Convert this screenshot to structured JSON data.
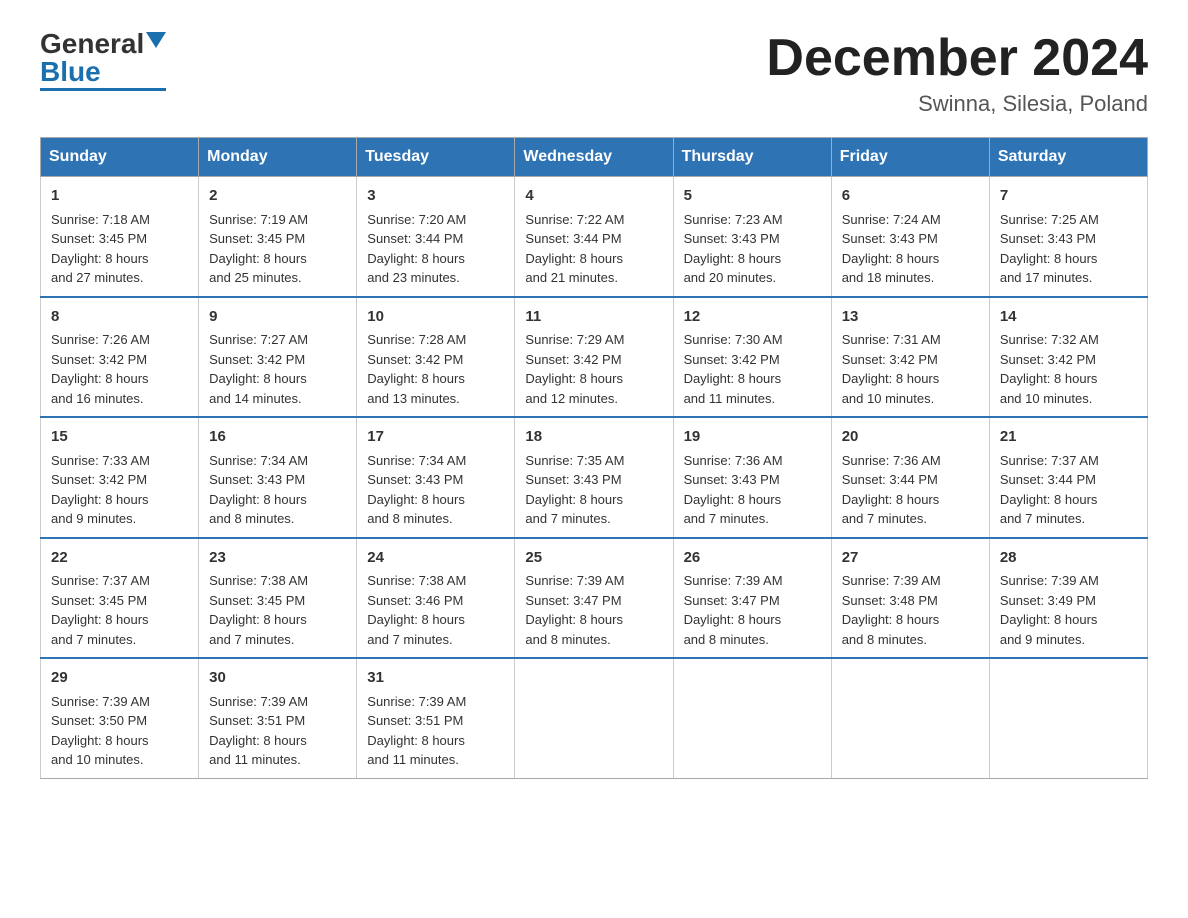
{
  "header": {
    "logo_text_general": "General",
    "logo_text_blue": "Blue",
    "month_title": "December 2024",
    "location": "Swinna, Silesia, Poland"
  },
  "days_of_week": [
    "Sunday",
    "Monday",
    "Tuesday",
    "Wednesday",
    "Thursday",
    "Friday",
    "Saturday"
  ],
  "weeks": [
    [
      {
        "day": "1",
        "sunrise": "7:18 AM",
        "sunset": "3:45 PM",
        "daylight": "8 hours and 27 minutes."
      },
      {
        "day": "2",
        "sunrise": "7:19 AM",
        "sunset": "3:45 PM",
        "daylight": "8 hours and 25 minutes."
      },
      {
        "day": "3",
        "sunrise": "7:20 AM",
        "sunset": "3:44 PM",
        "daylight": "8 hours and 23 minutes."
      },
      {
        "day": "4",
        "sunrise": "7:22 AM",
        "sunset": "3:44 PM",
        "daylight": "8 hours and 21 minutes."
      },
      {
        "day": "5",
        "sunrise": "7:23 AM",
        "sunset": "3:43 PM",
        "daylight": "8 hours and 20 minutes."
      },
      {
        "day": "6",
        "sunrise": "7:24 AM",
        "sunset": "3:43 PM",
        "daylight": "8 hours and 18 minutes."
      },
      {
        "day": "7",
        "sunrise": "7:25 AM",
        "sunset": "3:43 PM",
        "daylight": "8 hours and 17 minutes."
      }
    ],
    [
      {
        "day": "8",
        "sunrise": "7:26 AM",
        "sunset": "3:42 PM",
        "daylight": "8 hours and 16 minutes."
      },
      {
        "day": "9",
        "sunrise": "7:27 AM",
        "sunset": "3:42 PM",
        "daylight": "8 hours and 14 minutes."
      },
      {
        "day": "10",
        "sunrise": "7:28 AM",
        "sunset": "3:42 PM",
        "daylight": "8 hours and 13 minutes."
      },
      {
        "day": "11",
        "sunrise": "7:29 AM",
        "sunset": "3:42 PM",
        "daylight": "8 hours and 12 minutes."
      },
      {
        "day": "12",
        "sunrise": "7:30 AM",
        "sunset": "3:42 PM",
        "daylight": "8 hours and 11 minutes."
      },
      {
        "day": "13",
        "sunrise": "7:31 AM",
        "sunset": "3:42 PM",
        "daylight": "8 hours and 10 minutes."
      },
      {
        "day": "14",
        "sunrise": "7:32 AM",
        "sunset": "3:42 PM",
        "daylight": "8 hours and 10 minutes."
      }
    ],
    [
      {
        "day": "15",
        "sunrise": "7:33 AM",
        "sunset": "3:42 PM",
        "daylight": "8 hours and 9 minutes."
      },
      {
        "day": "16",
        "sunrise": "7:34 AM",
        "sunset": "3:43 PM",
        "daylight": "8 hours and 8 minutes."
      },
      {
        "day": "17",
        "sunrise": "7:34 AM",
        "sunset": "3:43 PM",
        "daylight": "8 hours and 8 minutes."
      },
      {
        "day": "18",
        "sunrise": "7:35 AM",
        "sunset": "3:43 PM",
        "daylight": "8 hours and 7 minutes."
      },
      {
        "day": "19",
        "sunrise": "7:36 AM",
        "sunset": "3:43 PM",
        "daylight": "8 hours and 7 minutes."
      },
      {
        "day": "20",
        "sunrise": "7:36 AM",
        "sunset": "3:44 PM",
        "daylight": "8 hours and 7 minutes."
      },
      {
        "day": "21",
        "sunrise": "7:37 AM",
        "sunset": "3:44 PM",
        "daylight": "8 hours and 7 minutes."
      }
    ],
    [
      {
        "day": "22",
        "sunrise": "7:37 AM",
        "sunset": "3:45 PM",
        "daylight": "8 hours and 7 minutes."
      },
      {
        "day": "23",
        "sunrise": "7:38 AM",
        "sunset": "3:45 PM",
        "daylight": "8 hours and 7 minutes."
      },
      {
        "day": "24",
        "sunrise": "7:38 AM",
        "sunset": "3:46 PM",
        "daylight": "8 hours and 7 minutes."
      },
      {
        "day": "25",
        "sunrise": "7:39 AM",
        "sunset": "3:47 PM",
        "daylight": "8 hours and 8 minutes."
      },
      {
        "day": "26",
        "sunrise": "7:39 AM",
        "sunset": "3:47 PM",
        "daylight": "8 hours and 8 minutes."
      },
      {
        "day": "27",
        "sunrise": "7:39 AM",
        "sunset": "3:48 PM",
        "daylight": "8 hours and 8 minutes."
      },
      {
        "day": "28",
        "sunrise": "7:39 AM",
        "sunset": "3:49 PM",
        "daylight": "8 hours and 9 minutes."
      }
    ],
    [
      {
        "day": "29",
        "sunrise": "7:39 AM",
        "sunset": "3:50 PM",
        "daylight": "8 hours and 10 minutes."
      },
      {
        "day": "30",
        "sunrise": "7:39 AM",
        "sunset": "3:51 PM",
        "daylight": "8 hours and 11 minutes."
      },
      {
        "day": "31",
        "sunrise": "7:39 AM",
        "sunset": "3:51 PM",
        "daylight": "8 hours and 11 minutes."
      },
      null,
      null,
      null,
      null
    ]
  ],
  "labels": {
    "sunrise": "Sunrise:",
    "sunset": "Sunset:",
    "daylight": "Daylight:"
  }
}
